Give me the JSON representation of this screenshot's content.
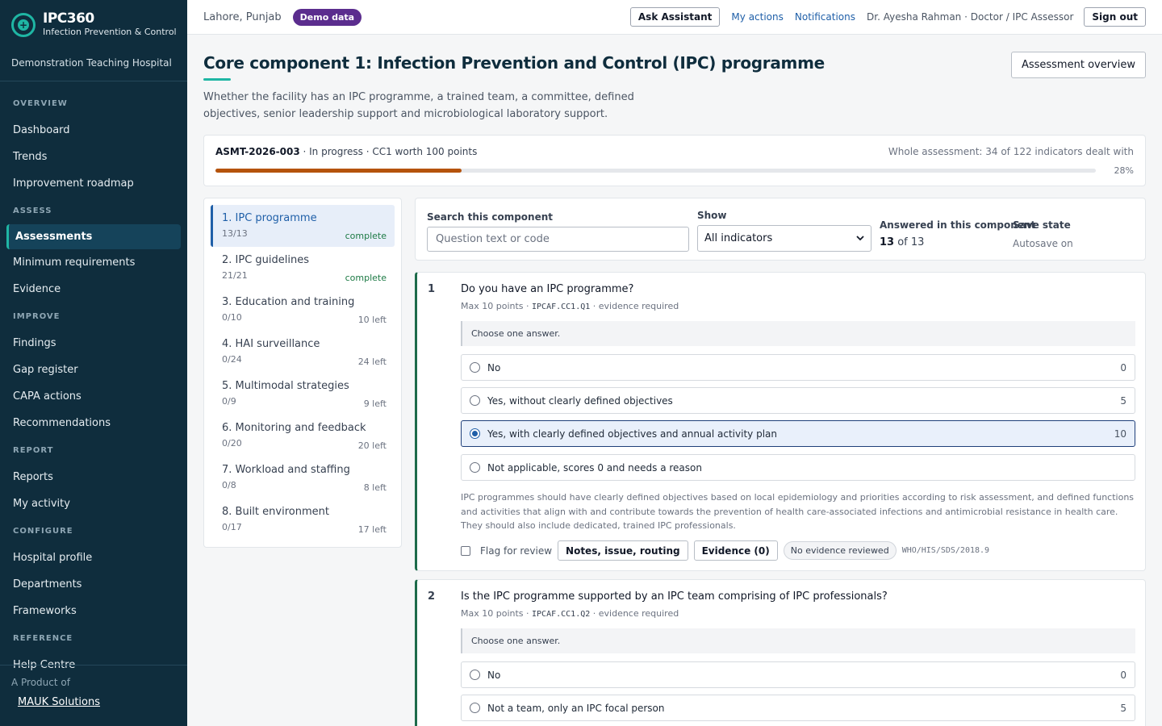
{
  "brand": {
    "name": "IPC360",
    "subtitle": "Infection Prevention & Control",
    "hospital": "Demonstration Teaching Hospital"
  },
  "sidebar": {
    "sections": [
      {
        "title": "OVERVIEW",
        "items": [
          "Dashboard",
          "Trends",
          "Improvement roadmap"
        ]
      },
      {
        "title": "ASSESS",
        "items": [
          "Assessments",
          "Minimum requirements",
          "Evidence"
        ]
      },
      {
        "title": "IMPROVE",
        "items": [
          "Findings",
          "Gap register",
          "CAPA actions",
          "Recommendations"
        ]
      },
      {
        "title": "REPORT",
        "items": [
          "Reports",
          "My activity"
        ]
      },
      {
        "title": "CONFIGURE",
        "items": [
          "Hospital profile",
          "Departments",
          "Frameworks"
        ]
      },
      {
        "title": "REFERENCE",
        "items": [
          "Help Centre"
        ]
      }
    ],
    "active_item": "Assessments",
    "footer": {
      "product_of": "A Product of",
      "company": "MAUK Solutions"
    }
  },
  "topbar": {
    "location": "Lahore, Punjab",
    "badge": "Demo data",
    "ask_assistant": "Ask Assistant",
    "my_actions": "My actions",
    "notifications": "Notifications",
    "user": "Dr. Ayesha Rahman · Doctor / IPC Assessor",
    "sign_out": "Sign out"
  },
  "page": {
    "title": "Core component 1: Infection Prevention and Control (IPC) programme",
    "overview_button": "Assessment overview",
    "description": "Whether the facility has an IPC programme, a trained team, a committee, defined objectives, senior leadership support and microbiological laboratory support."
  },
  "progress": {
    "assessment_id": "ASMT-2026-003",
    "status": " · In progress · CC1 worth 100 points",
    "summary": "Whole assessment: 34 of 122 indicators dealt with",
    "percent_label": "28%",
    "percent": 28,
    "fill_color": "#b5530c"
  },
  "components": [
    {
      "name": "1. IPC programme",
      "count": "13/13",
      "status": "complete",
      "active": true
    },
    {
      "name": "2. IPC guidelines",
      "count": "21/21",
      "status": "complete",
      "active": false
    },
    {
      "name": "3. Education and training",
      "count": "0/10",
      "status": "10 left",
      "active": false
    },
    {
      "name": "4. HAI surveillance",
      "count": "0/24",
      "status": "24 left",
      "active": false
    },
    {
      "name": "5. Multimodal strategies",
      "count": "0/9",
      "status": "9 left",
      "active": false
    },
    {
      "name": "6. Monitoring and feedback",
      "count": "0/20",
      "status": "20 left",
      "active": false
    },
    {
      "name": "7. Workload and staffing",
      "count": "0/8",
      "status": "8 left",
      "active": false
    },
    {
      "name": "8. Built environment",
      "count": "0/17",
      "status": "17 left",
      "active": false
    }
  ],
  "filters": {
    "search_label": "Search this component",
    "search_placeholder": "Question text or code",
    "show_label": "Show",
    "show_value": "All indicators",
    "answered_label": "Answered in this component",
    "answered_count": "13",
    "answered_of": " of 13",
    "save_label": "Save state",
    "save_value": "Autosave on"
  },
  "questions": [
    {
      "number": "1",
      "text": "Do you have an IPC programme?",
      "meta_max": "Max 10 points · ",
      "code": "IPCAF.CC1.Q1",
      "meta_evidence": " · evidence required",
      "hint": "Choose one answer.",
      "options": [
        {
          "label": "No",
          "score": "0",
          "selected": false
        },
        {
          "label": "Yes, without clearly defined objectives",
          "score": "5",
          "selected": false
        },
        {
          "label": "Yes, with clearly defined objectives and annual activity plan",
          "score": "10",
          "selected": true
        },
        {
          "label": "Not applicable, scores 0 and needs a reason",
          "score": "",
          "selected": false
        }
      ],
      "guidance": "IPC programmes should have clearly defined objectives based on local epidemiology and priorities according to risk assessment, and defined functions and activities that align with and contribute towards the prevention of health care-associated infections and antimicrobial resistance in health care. They should also include dedicated, trained IPC professionals.",
      "flag_label": "Flag for review",
      "notes_button": "Notes, issue, routing",
      "evidence_button": "Evidence (0)",
      "evidence_status": "No evidence reviewed",
      "reference": "WHO/HIS/SDS/2018.9"
    },
    {
      "number": "2",
      "text": "Is the IPC programme supported by an IPC team comprising of IPC professionals?",
      "meta_max": "Max 10 points · ",
      "code": "IPCAF.CC1.Q2",
      "meta_evidence": " · evidence required",
      "hint": "Choose one answer.",
      "options": [
        {
          "label": "No",
          "score": "0",
          "selected": false
        },
        {
          "label": "Not a team, only an IPC focal person",
          "score": "5",
          "selected": false
        }
      ]
    }
  ]
}
